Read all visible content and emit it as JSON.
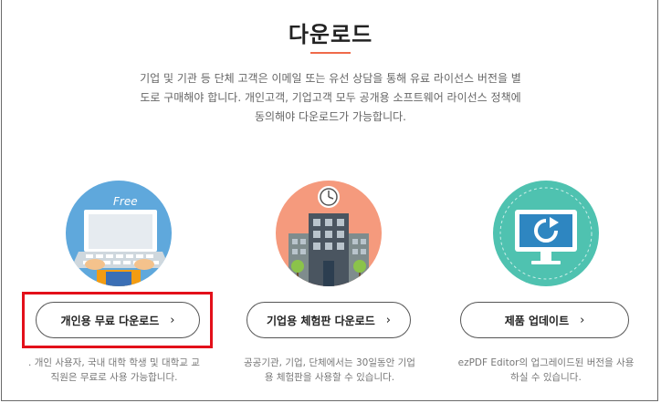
{
  "header": {
    "title": "다운로드"
  },
  "description": [
    "기업 및 기관 등 단체 고객은 이메일 또는 유선 상담을 통해 유료 라이선스 버전을 별",
    "도로 구매해야 합니다. 개인고객, 기업고객 모두 공개용 소프트웨어 라이선스 정책에",
    "동의해야 다운로드가 가능합니다."
  ],
  "cards": [
    {
      "badge": "Free",
      "button": "개인용 무료 다운로드",
      "note": [
        ". 개인 사용자, 국내 대학 학생 및 대학교 교",
        "직원은 무료로 사용 가능합니다."
      ]
    },
    {
      "button": "기업용 체험판 다운로드",
      "note": [
        "공공기관, 기업, 단체에서는 30일동안 기업",
        "용 체험판을 사용할 수 있습니다."
      ]
    },
    {
      "button": "제품 업데이트",
      "note": [
        "ezPDF Editor의 업그레이드된 버전을 사용",
        "하실 수 있습니다."
      ]
    }
  ],
  "icons": {
    "chevron": "›",
    "card1": "laptop-free-icon",
    "card2": "building-clock-icon",
    "card3": "monitor-update-icon"
  },
  "colors": {
    "accent": "#ef6a4a",
    "highlight": "#e3101a",
    "card1_bg": "#5fa8dc",
    "card2_bg": "#f59a7d",
    "card3_bg": "#4fc2b0"
  }
}
